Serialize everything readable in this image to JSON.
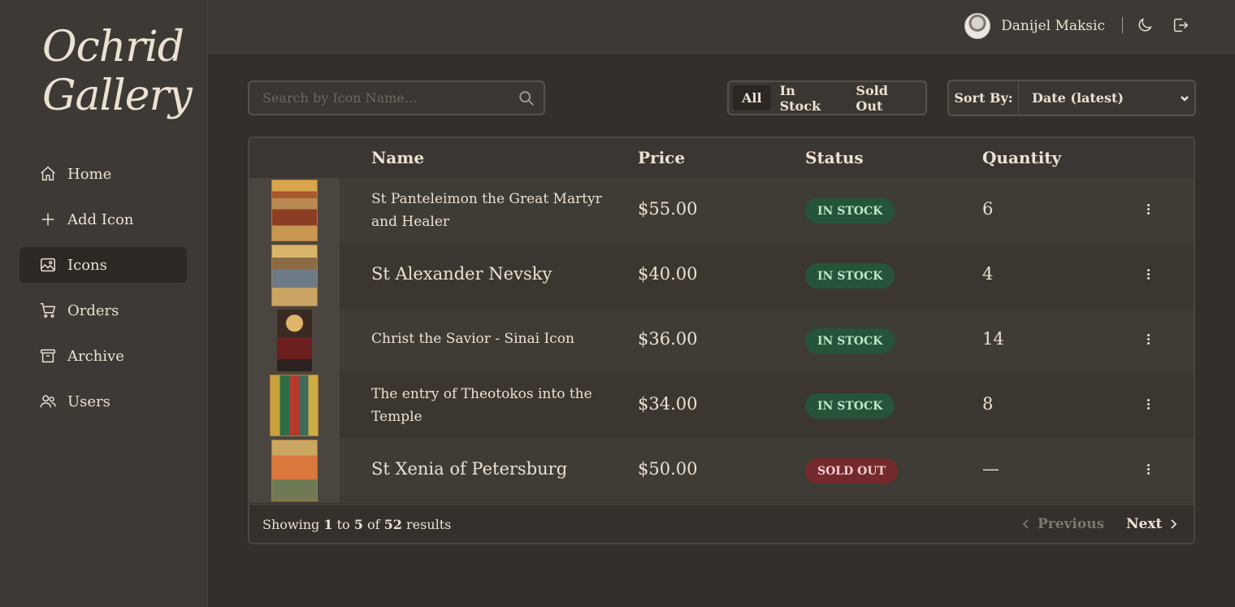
{
  "brand": {
    "line1": "Ochrid",
    "line2": "Gallery"
  },
  "sidebar": {
    "items": [
      {
        "label": "Home",
        "icon": "home-icon"
      },
      {
        "label": "Add Icon",
        "icon": "plus-icon"
      },
      {
        "label": "Icons",
        "icon": "image-icon",
        "active": true
      },
      {
        "label": "Orders",
        "icon": "cart-icon"
      },
      {
        "label": "Archive",
        "icon": "archive-icon"
      },
      {
        "label": "Users",
        "icon": "users-icon"
      }
    ]
  },
  "header": {
    "user_name": "Danijel Maksic",
    "theme_icon": "moon-icon",
    "logout_icon": "logout-icon"
  },
  "search": {
    "placeholder": "Search by Icon Name...",
    "value": ""
  },
  "filter": {
    "options": [
      "All",
      "In Stock",
      "Sold Out"
    ],
    "selected": "All"
  },
  "sort": {
    "label": "Sort By:",
    "selected": "Date (latest)"
  },
  "table": {
    "columns": [
      "Name",
      "Price",
      "Status",
      "Quantity"
    ],
    "rows": [
      {
        "name": "St Panteleimon the Great Martyr and Healer",
        "price": "$55.00",
        "status": "IN STOCK",
        "quantity": "6"
      },
      {
        "name": "St Alexander Nevsky",
        "price": "$40.00",
        "status": "IN STOCK",
        "quantity": "4"
      },
      {
        "name": "Christ the Savior - Sinai Icon",
        "price": "$36.00",
        "status": "IN STOCK",
        "quantity": "14"
      },
      {
        "name": "The entry of Theotokos into the Temple",
        "price": "$34.00",
        "status": "IN STOCK",
        "quantity": "8"
      },
      {
        "name": "St Xenia of Petersburg",
        "price": "$50.00",
        "status": "SOLD OUT",
        "quantity": "—"
      }
    ]
  },
  "pagination": {
    "showing_word": "Showing",
    "from": "1",
    "to_word": "to",
    "to": "5",
    "of_word": "of",
    "total": "52",
    "results_word": "results",
    "previous_label": "Previous",
    "next_label": "Next"
  },
  "colors": {
    "background": "#33302b",
    "sidebar": "#3d3a35",
    "text": "#ece1d2",
    "in_stock_bg": "#25543a",
    "in_stock_text": "#b9e6c7",
    "sold_out_bg": "#742a2c",
    "sold_out_text": "#f3cfcf"
  }
}
